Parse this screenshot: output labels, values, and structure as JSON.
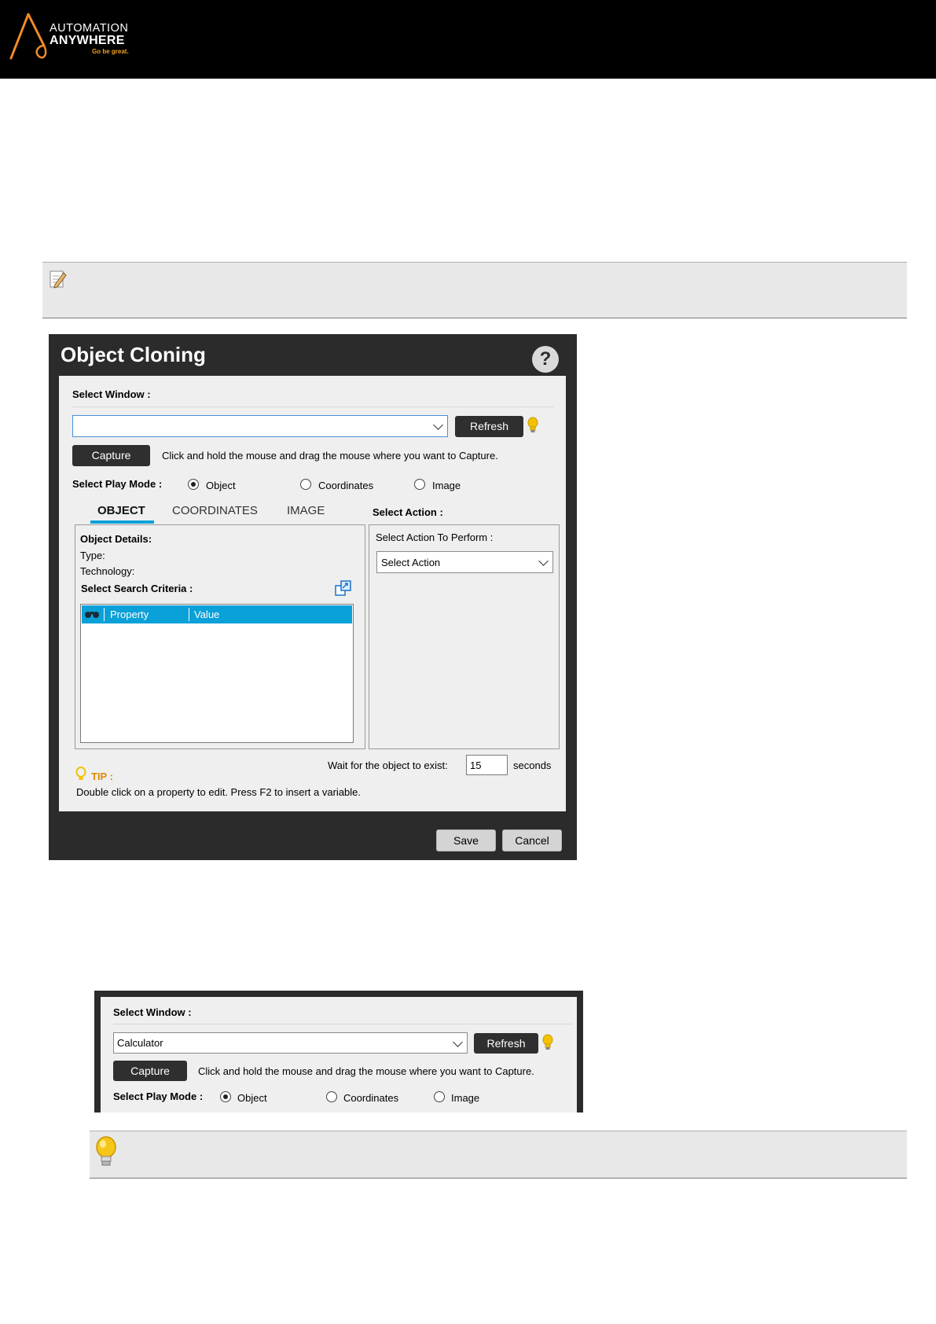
{
  "header": {
    "logo_line1": "AUTOMATION",
    "logo_line2": "ANYWHERE",
    "logo_tagline": "Go be great."
  },
  "note_box": {
    "icon": "note-pencil-icon"
  },
  "dialog": {
    "title": "Object Cloning",
    "help_label": "?",
    "select_window_label": "Select Window :",
    "window_value": "",
    "refresh_label": "Refresh",
    "capture_label": "Capture",
    "capture_hint": "Click and hold the mouse and drag the mouse where you want to Capture.",
    "play_mode_label": "Select Play Mode :",
    "modes": [
      "Object",
      "Coordinates",
      "Image"
    ],
    "selected_mode": "Object",
    "tabs": [
      "OBJECT",
      "COORDINATES",
      "IMAGE"
    ],
    "active_tab": "OBJECT",
    "object_details_label": "Object Details:",
    "type_label": "Type:",
    "technology_label": "Technology:",
    "search_criteria_label": "Select Search Criteria :",
    "grid_columns": [
      "Property",
      "Value"
    ],
    "select_action_label": "Select Action :",
    "action_to_perform_label": "Select Action To Perform :",
    "action_value": "Select Action",
    "wait_label": "Wait for the object to exist:",
    "wait_value": "15",
    "seconds_label": "seconds",
    "tip_label": "TIP :",
    "tip_text": "Double click on a property to edit. Press F2 to insert a variable.",
    "save_label": "Save",
    "cancel_label": "Cancel"
  },
  "dialog2": {
    "select_window_label": "Select Window :",
    "window_value": "Calculator",
    "refresh_label": "Refresh",
    "capture_label": "Capture",
    "capture_hint": "Click and hold the mouse and drag the mouse where you want to Capture.",
    "play_mode_label": "Select Play Mode :",
    "modes": [
      "Object",
      "Coordinates",
      "Image"
    ],
    "selected_mode": "Object"
  },
  "tip_box": {
    "icon": "lightbulb-icon"
  },
  "colors": {
    "header_bg": "#000000",
    "accent_blue": "#0aa0d8",
    "tip_orange": "#e08a00",
    "bulb_yellow": "#f2c200"
  }
}
